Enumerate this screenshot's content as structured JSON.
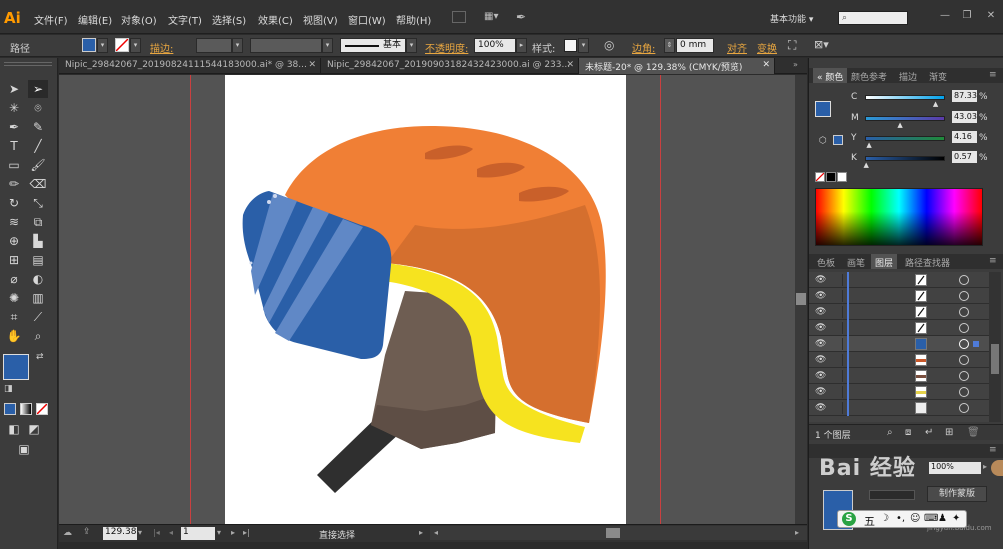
{
  "app": {
    "logo": "Ai"
  },
  "menu": [
    "文件(F)",
    "编辑(E)",
    "对象(O)",
    "文字(T)",
    "选择(S)",
    "效果(C)",
    "视图(V)",
    "窗口(W)",
    "帮助(H)"
  ],
  "workspace": {
    "label": "基本功能"
  },
  "options_bar": {
    "object_type": "路径",
    "stroke_label": "描边:",
    "stroke_style": "基本",
    "opacity_label": "不透明度:",
    "opacity_value": "100%",
    "style_label": "样式:",
    "corner_label": "边角:",
    "corner_value": "0 mm",
    "align_label": "对齐",
    "transform_label": "变换"
  },
  "document_tabs": [
    {
      "label": "Nipic_29842067_20190824111544183000.ai* @ 38...",
      "active": false
    },
    {
      "label": "Nipic_29842067_20190903182432423000.ai @ 233...",
      "active": false
    },
    {
      "label": "未标题-20* @ 129.38% (CMYK/预览)",
      "active": true
    }
  ],
  "status_bar": {
    "zoom": "129.38",
    "page": "1",
    "tool": "直接选择"
  },
  "color_panel": {
    "tabs": [
      "颜色",
      "颜色参考",
      "描边",
      "渐变"
    ],
    "active_tab": "颜色",
    "fill_color": "#2a5fa8",
    "sliders": [
      {
        "channel": "C",
        "value": "87.33",
        "percent": 87.33
      },
      {
        "channel": "M",
        "value": "43.03",
        "percent": 43.03
      },
      {
        "channel": "Y",
        "value": "4.16",
        "percent": 4.16
      },
      {
        "channel": "K",
        "value": "0.57",
        "percent": 0.57
      }
    ]
  },
  "layers_panel": {
    "tabs": [
      "色板",
      "画笔",
      "图层",
      "路径查找器"
    ],
    "active_tab": "图层",
    "count_label": "1 个图层",
    "rows": [
      {
        "thumb": "stroke-line",
        "color": "#ffffff",
        "selected": false
      },
      {
        "thumb": "stroke-line",
        "color": "#ffffff",
        "selected": false
      },
      {
        "thumb": "stroke-line",
        "color": "#ffffff",
        "selected": false
      },
      {
        "thumb": "stroke-line",
        "color": "#ffffff",
        "selected": false
      },
      {
        "thumb": "visor",
        "color": "#2a5fa8",
        "selected": true
      },
      {
        "thumb": "stripe",
        "color": "#c8582a",
        "selected": false
      },
      {
        "thumb": "stripe",
        "color": "#7a5040",
        "selected": false
      },
      {
        "thumb": "stripe",
        "color": "#e5d24a",
        "selected": false
      },
      {
        "thumb": "blank",
        "color": "#eeeeee",
        "selected": false
      }
    ]
  },
  "bottom_panel": {
    "opacity_value": "100%",
    "button_label": "制作蒙版"
  },
  "watermark": {
    "text": "Bai 经验",
    "sub": "jingyan.baidu.com"
  },
  "ime_bar": {
    "items": [
      "S",
      "五",
      "☽",
      "•,",
      "☺",
      "⌨",
      "♟",
      "✦"
    ]
  },
  "colors": {
    "helmet_orange": "#f07f35",
    "helmet_shade": "#d56f2e",
    "helmet_vent": "#c9602a",
    "visor_blue": "#2a5fa8",
    "visor_light": "#6088c6",
    "liner_yellow": "#f6e31f",
    "ear_pad": "#6e5d52",
    "ear_pad_dark": "#5e4e45",
    "strap": "#2f2f2f"
  }
}
